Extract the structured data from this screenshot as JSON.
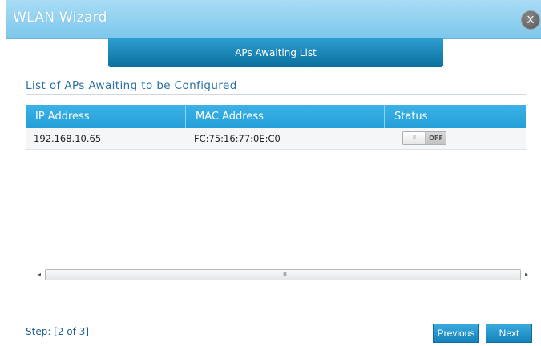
{
  "window": {
    "title": "WLAN Wizard",
    "close_label": "X"
  },
  "step_tab": {
    "label": "APs Awaiting List"
  },
  "section": {
    "title": "List of APs Awaiting to be Configured"
  },
  "table": {
    "columns": [
      "IP Address",
      "MAC Address",
      "Status"
    ],
    "rows": [
      {
        "ip": "192.168.10.65",
        "mac": "FC:75:16:77:0E:C0",
        "status": "OFF"
      }
    ]
  },
  "toggle": {
    "grip": "III"
  },
  "scrollbar": {
    "left_arrow": "◂",
    "right_arrow": "▸",
    "grip": "III"
  },
  "footer": {
    "step_text": "Step: [2 of 3]",
    "previous_label": "Previous",
    "next_label": "Next"
  },
  "colors": {
    "titlebar": "#7cc7ec",
    "accent": "#1583bb",
    "header": "#239fd8"
  }
}
